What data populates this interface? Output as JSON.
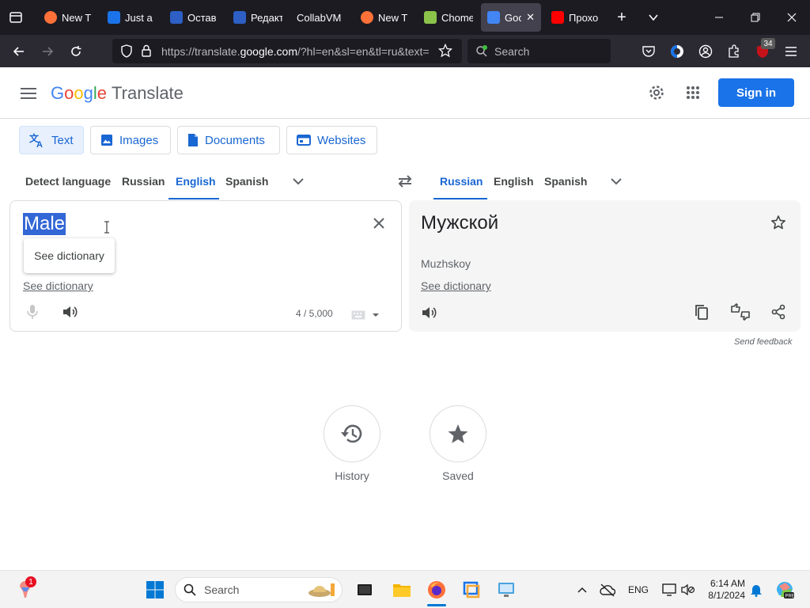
{
  "browser": {
    "tabs": [
      {
        "title": "New T",
        "icon": "firefox-icon",
        "color": "#ff7139"
      },
      {
        "title": "Just a",
        "icon": "link-icon",
        "color": "#1a73e8"
      },
      {
        "title": "Остав",
        "icon": "telegraph-icon",
        "color": "#2d5fc4"
      },
      {
        "title": "Редакт",
        "icon": "telegraph-icon",
        "color": "#2d5fc4"
      },
      {
        "title": "CollabVM",
        "icon": "none",
        "color": "#1c1b22"
      },
      {
        "title": "New T",
        "icon": "firefox-icon",
        "color": "#ff7139"
      },
      {
        "title": "Chome",
        "icon": "chome-icon",
        "color": "#8bc34a"
      },
      {
        "title": "Goo",
        "icon": "google-translate-icon",
        "color": "#4285f4"
      },
      {
        "title": "Прохо",
        "icon": "youtube-icon",
        "color": "#ff0000"
      }
    ],
    "url_prefix": "https://translate.",
    "url_domain": "google.com",
    "url_suffix": "/?hl=en&sl=en&tl=ru&text=",
    "search_placeholder": "Search",
    "extension_badge": "34"
  },
  "header": {
    "logo_letters": [
      "G",
      "o",
      "o",
      "g",
      "l",
      "e"
    ],
    "product": "Translate",
    "sign_in": "Sign in"
  },
  "modes": [
    {
      "label": "Text",
      "icon": "translate-icon"
    },
    {
      "label": "Images",
      "icon": "image-icon"
    },
    {
      "label": "Documents",
      "icon": "document-icon"
    },
    {
      "label": "Websites",
      "icon": "website-icon"
    }
  ],
  "source_langs": [
    "Detect language",
    "Russian",
    "English",
    "Spanish"
  ],
  "target_langs": [
    "Russian",
    "English",
    "Spanish"
  ],
  "source": {
    "text": "Male",
    "tooltip": "See dictionary",
    "dictionary_link": "See dictionary",
    "char_count": "4 / 5,000"
  },
  "target": {
    "text": "Мужской",
    "transliteration": "Muzhskoy",
    "dictionary_link": "See dictionary"
  },
  "send_feedback": "Send feedback",
  "bottom": {
    "history": "History",
    "saved": "Saved"
  },
  "taskbar": {
    "search": "Search",
    "notification_count": "1",
    "lang": "ENG",
    "time": "6:14 AM",
    "date": "8/1/2024"
  }
}
